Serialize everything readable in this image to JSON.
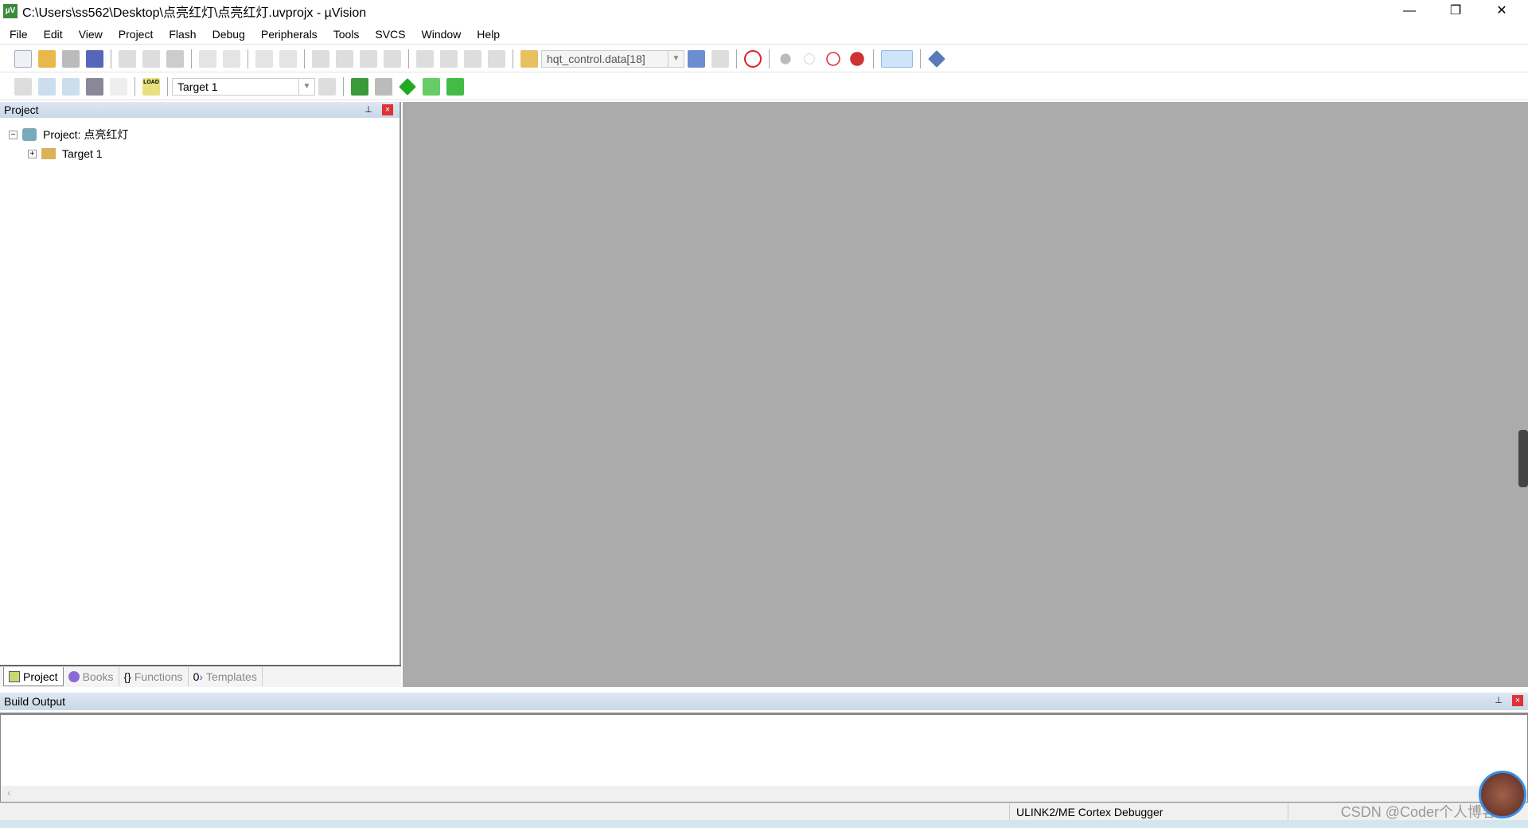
{
  "window": {
    "title": "C:\\Users\\ss562\\Desktop\\点亮红灯\\点亮红灯.uvprojx - µVision",
    "minimize": "—",
    "restore": "❐",
    "close": "✕"
  },
  "menu": [
    "File",
    "Edit",
    "View",
    "Project",
    "Flash",
    "Debug",
    "Peripherals",
    "Tools",
    "SVCS",
    "Window",
    "Help"
  ],
  "toolbar": {
    "find_combo": "hqt_control.data[18]",
    "target_combo": "Target 1",
    "load_label": "LOAD"
  },
  "project_panel": {
    "title": "Project",
    "pin": "📌",
    "close": "×",
    "project_node": "Project: 点亮红灯",
    "target_node": "Target 1",
    "expand_minus": "−",
    "expand_plus": "+"
  },
  "tabs": [
    {
      "label": "Project"
    },
    {
      "label": "Books"
    },
    {
      "label": "Functions"
    },
    {
      "label": "Templates"
    }
  ],
  "build_output": {
    "title": "Build Output",
    "scroll_left": "‹"
  },
  "status": {
    "debugger": "ULINK2/ME Cortex Debugger"
  },
  "watermark": "CSDN @Coder个人博客",
  "colors": {
    "editor_bg": "#ababab",
    "panel_header": "#c9d7e7",
    "close_red": "#dd3333"
  }
}
